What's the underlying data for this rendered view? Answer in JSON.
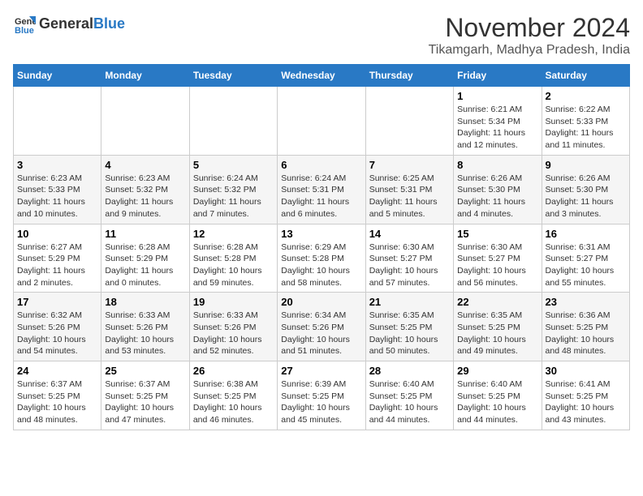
{
  "logo": {
    "line1": "General",
    "line2": "Blue"
  },
  "title": "November 2024",
  "location": "Tikamgarh, Madhya Pradesh, India",
  "days_of_week": [
    "Sunday",
    "Monday",
    "Tuesday",
    "Wednesday",
    "Thursday",
    "Friday",
    "Saturday"
  ],
  "weeks": [
    [
      {
        "day": "",
        "info": ""
      },
      {
        "day": "",
        "info": ""
      },
      {
        "day": "",
        "info": ""
      },
      {
        "day": "",
        "info": ""
      },
      {
        "day": "",
        "info": ""
      },
      {
        "day": "1",
        "info": "Sunrise: 6:21 AM\nSunset: 5:34 PM\nDaylight: 11 hours\nand 12 minutes."
      },
      {
        "day": "2",
        "info": "Sunrise: 6:22 AM\nSunset: 5:33 PM\nDaylight: 11 hours\nand 11 minutes."
      }
    ],
    [
      {
        "day": "3",
        "info": "Sunrise: 6:23 AM\nSunset: 5:33 PM\nDaylight: 11 hours\nand 10 minutes."
      },
      {
        "day": "4",
        "info": "Sunrise: 6:23 AM\nSunset: 5:32 PM\nDaylight: 11 hours\nand 9 minutes."
      },
      {
        "day": "5",
        "info": "Sunrise: 6:24 AM\nSunset: 5:32 PM\nDaylight: 11 hours\nand 7 minutes."
      },
      {
        "day": "6",
        "info": "Sunrise: 6:24 AM\nSunset: 5:31 PM\nDaylight: 11 hours\nand 6 minutes."
      },
      {
        "day": "7",
        "info": "Sunrise: 6:25 AM\nSunset: 5:31 PM\nDaylight: 11 hours\nand 5 minutes."
      },
      {
        "day": "8",
        "info": "Sunrise: 6:26 AM\nSunset: 5:30 PM\nDaylight: 11 hours\nand 4 minutes."
      },
      {
        "day": "9",
        "info": "Sunrise: 6:26 AM\nSunset: 5:30 PM\nDaylight: 11 hours\nand 3 minutes."
      }
    ],
    [
      {
        "day": "10",
        "info": "Sunrise: 6:27 AM\nSunset: 5:29 PM\nDaylight: 11 hours\nand 2 minutes."
      },
      {
        "day": "11",
        "info": "Sunrise: 6:28 AM\nSunset: 5:29 PM\nDaylight: 11 hours\nand 0 minutes."
      },
      {
        "day": "12",
        "info": "Sunrise: 6:28 AM\nSunset: 5:28 PM\nDaylight: 10 hours\nand 59 minutes."
      },
      {
        "day": "13",
        "info": "Sunrise: 6:29 AM\nSunset: 5:28 PM\nDaylight: 10 hours\nand 58 minutes."
      },
      {
        "day": "14",
        "info": "Sunrise: 6:30 AM\nSunset: 5:27 PM\nDaylight: 10 hours\nand 57 minutes."
      },
      {
        "day": "15",
        "info": "Sunrise: 6:30 AM\nSunset: 5:27 PM\nDaylight: 10 hours\nand 56 minutes."
      },
      {
        "day": "16",
        "info": "Sunrise: 6:31 AM\nSunset: 5:27 PM\nDaylight: 10 hours\nand 55 minutes."
      }
    ],
    [
      {
        "day": "17",
        "info": "Sunrise: 6:32 AM\nSunset: 5:26 PM\nDaylight: 10 hours\nand 54 minutes."
      },
      {
        "day": "18",
        "info": "Sunrise: 6:33 AM\nSunset: 5:26 PM\nDaylight: 10 hours\nand 53 minutes."
      },
      {
        "day": "19",
        "info": "Sunrise: 6:33 AM\nSunset: 5:26 PM\nDaylight: 10 hours\nand 52 minutes."
      },
      {
        "day": "20",
        "info": "Sunrise: 6:34 AM\nSunset: 5:26 PM\nDaylight: 10 hours\nand 51 minutes."
      },
      {
        "day": "21",
        "info": "Sunrise: 6:35 AM\nSunset: 5:25 PM\nDaylight: 10 hours\nand 50 minutes."
      },
      {
        "day": "22",
        "info": "Sunrise: 6:35 AM\nSunset: 5:25 PM\nDaylight: 10 hours\nand 49 minutes."
      },
      {
        "day": "23",
        "info": "Sunrise: 6:36 AM\nSunset: 5:25 PM\nDaylight: 10 hours\nand 48 minutes."
      }
    ],
    [
      {
        "day": "24",
        "info": "Sunrise: 6:37 AM\nSunset: 5:25 PM\nDaylight: 10 hours\nand 48 minutes."
      },
      {
        "day": "25",
        "info": "Sunrise: 6:37 AM\nSunset: 5:25 PM\nDaylight: 10 hours\nand 47 minutes."
      },
      {
        "day": "26",
        "info": "Sunrise: 6:38 AM\nSunset: 5:25 PM\nDaylight: 10 hours\nand 46 minutes."
      },
      {
        "day": "27",
        "info": "Sunrise: 6:39 AM\nSunset: 5:25 PM\nDaylight: 10 hours\nand 45 minutes."
      },
      {
        "day": "28",
        "info": "Sunrise: 6:40 AM\nSunset: 5:25 PM\nDaylight: 10 hours\nand 44 minutes."
      },
      {
        "day": "29",
        "info": "Sunrise: 6:40 AM\nSunset: 5:25 PM\nDaylight: 10 hours\nand 44 minutes."
      },
      {
        "day": "30",
        "info": "Sunrise: 6:41 AM\nSunset: 5:25 PM\nDaylight: 10 hours\nand 43 minutes."
      }
    ]
  ]
}
